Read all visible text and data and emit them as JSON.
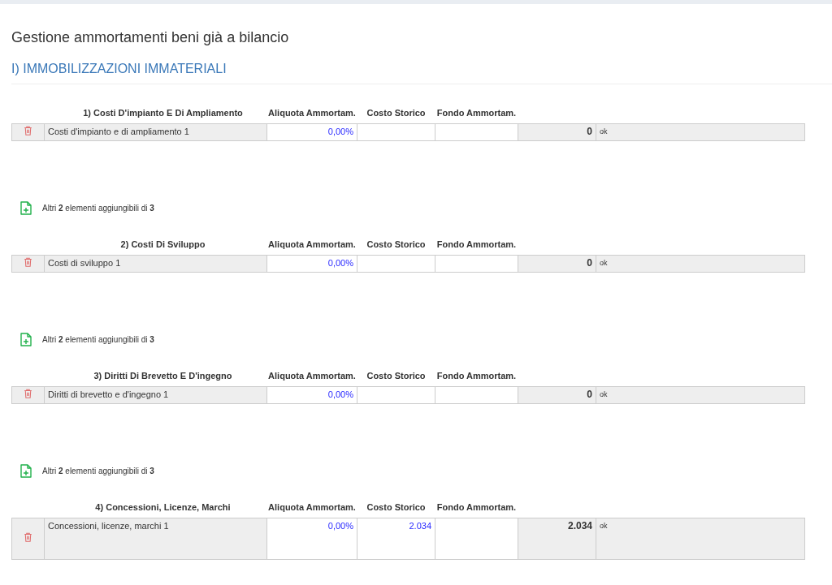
{
  "page_title": "Gestione ammortamenti beni già a bilancio",
  "section_title": "I) IMMOBILIZZAZIONI IMMATERIALI",
  "groups": [
    {
      "title": "1) Costi D'impianto E Di Ampliamento",
      "columns": [
        "Aliquota Ammortam.",
        "Costo Storico",
        "Fondo Ammortam."
      ],
      "rows": [
        {
          "kind": "single",
          "name": "Costi d'impianto e di ampliamento 1",
          "aliquota": "0,00%",
          "costo": "",
          "fondo": "",
          "total": "0",
          "status": "ok"
        }
      ],
      "add_note": "Altri **2** elementi aggiungibili di **3**"
    },
    {
      "title": "2) Costi Di Sviluppo",
      "columns": [
        "Aliquota Ammortam.",
        "Costo Storico",
        "Fondo Ammortam."
      ],
      "rows": [
        {
          "kind": "single",
          "name": "Costi di sviluppo 1",
          "aliquota": "0,00%",
          "costo": "",
          "fondo": "",
          "total": "0",
          "status": "ok"
        }
      ],
      "add_note": "Altri **2** elementi aggiungibili di **3**"
    },
    {
      "title": "3) Diritti Di Brevetto E D'ingegno",
      "columns": [
        "Aliquota Ammortam.",
        "Costo Storico",
        "Fondo Ammortam."
      ],
      "rows": [
        {
          "kind": "single",
          "name": "Diritti di brevetto e d'ingegno 1",
          "aliquota": "0,00%",
          "costo": "",
          "fondo": "",
          "total": "0",
          "status": "ok"
        }
      ],
      "add_note": "Altri **2** elementi aggiungibili di **3**"
    },
    {
      "title": "4) Concessioni, Licenze, Marchi",
      "columns": [
        "Aliquota Ammortam.",
        "Costo Storico",
        "Fondo Ammortam."
      ],
      "rows": [
        {
          "kind": "multiline",
          "name": "Concessioni, licenze, marchi 1",
          "aliquota": "0,00%",
          "costo": "2.034",
          "fondo": "",
          "total": "2.034",
          "status": "ok"
        }
      ]
    }
  ]
}
